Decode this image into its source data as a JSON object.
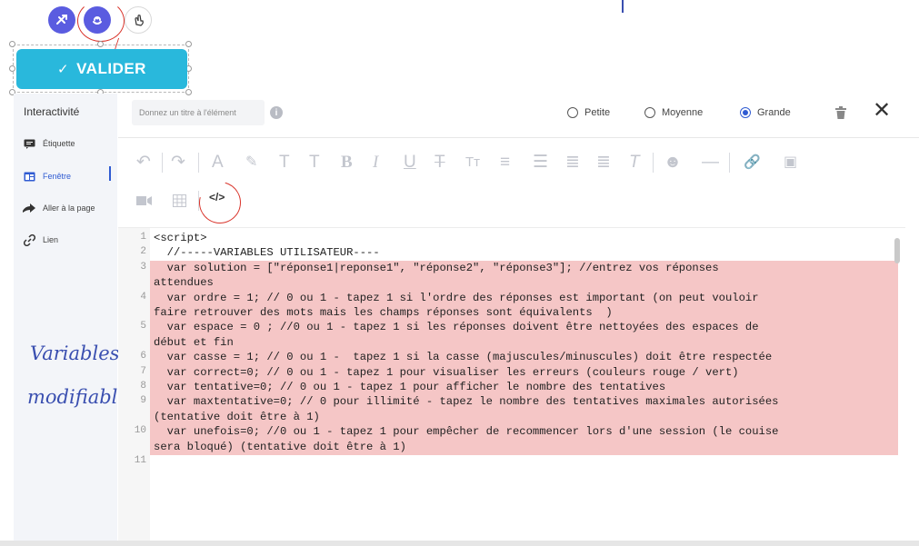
{
  "button": {
    "label": "VALIDER",
    "icon": "check-icon"
  },
  "sidebar": {
    "title": "Interactivité",
    "items": [
      {
        "label": "Étiquette",
        "icon": "label-icon"
      },
      {
        "label": "Fenêtre",
        "icon": "window-icon",
        "active": true
      },
      {
        "label": "Aller à la page",
        "icon": "arrow-right-icon"
      },
      {
        "label": "Lien",
        "icon": "link-icon"
      }
    ]
  },
  "annotation": {
    "line1": "Variables",
    "line2": "modifiables"
  },
  "header": {
    "title_placeholder": "Donnez un titre à l'élément",
    "size_options": [
      {
        "label": "Petite",
        "selected": false
      },
      {
        "label": "Moyenne",
        "selected": false
      },
      {
        "label": "Grande",
        "selected": true
      }
    ]
  },
  "colors": {
    "accent": "#2f5bd2",
    "button": "#29b8dc",
    "highlight": "#f5c6c6",
    "annotation": "#d9342b"
  },
  "code": {
    "lines": [
      {
        "n": "1",
        "rows": [
          "<script>"
        ],
        "hl": false
      },
      {
        "n": "2",
        "rows": [
          "  //-----VARIABLES UTILISATEUR----"
        ],
        "hl": false
      },
      {
        "n": "3",
        "rows": [
          "  var solution = [\"réponse1|reponse1\", \"réponse2\", \"réponse3\"]; //entrez vos réponses",
          "attendues"
        ],
        "hl": true
      },
      {
        "n": "4",
        "rows": [
          "  var ordre = 1; // 0 ou 1 - tapez 1 si l'ordre des réponses est important (on peut vouloir",
          "faire retrouver des mots mais les champs réponses sont équivalents  )"
        ],
        "hl": true
      },
      {
        "n": "5",
        "rows": [
          "  var espace = 0 ; //0 ou 1 - tapez 1 si les réponses doivent être nettoyées des espaces de",
          "début et fin"
        ],
        "hl": true
      },
      {
        "n": "6",
        "rows": [
          "  var casse = 1; // 0 ou 1 -  tapez 1 si la casse (majuscules/minuscules) doit être respectée"
        ],
        "hl": true
      },
      {
        "n": "7",
        "rows": [
          "  var correct=0; // 0 ou 1 - tapez 1 pour visualiser les erreurs (couleurs rouge / vert)"
        ],
        "hl": true
      },
      {
        "n": "8",
        "rows": [
          "  var tentative=0; // 0 ou 1 - tapez 1 pour afficher le nombre des tentatives"
        ],
        "hl": true
      },
      {
        "n": "9",
        "rows": [
          "  var maxtentative=0; // 0 pour illimité - tapez le nombre des tentatives maximales autorisées",
          "(tentative doit être à 1)"
        ],
        "hl": true
      },
      {
        "n": "10",
        "rows": [
          "  var unefois=0; //0 ou 1 - tapez 1 pour empêcher de recommencer lors d'une session (le couise",
          "sera bloqué) (tentative doit être à 1)"
        ],
        "hl": true
      },
      {
        "n": "11",
        "rows": [
          ""
        ],
        "hl": false
      }
    ]
  }
}
